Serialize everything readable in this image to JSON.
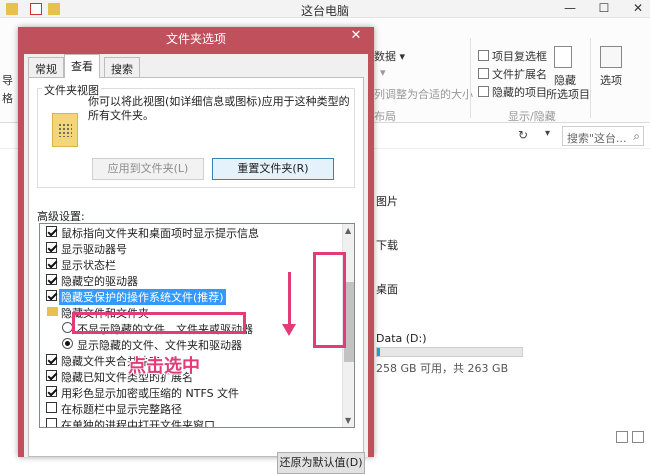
{
  "explorer": {
    "title": "这台电脑",
    "ribbon": {
      "data_partial": "数据",
      "data_arrow": "▾",
      "adjust_text": "列调整为合适的大小",
      "items_check_label": "项目复选框",
      "ext_check_label": "文件扩展名",
      "hidden_check_label": "隐藏的项目",
      "hide_btn_label": "隐藏",
      "hide_btn_label2": "所选项目",
      "options_label": "选项",
      "group_label": "显示/隐藏",
      "group2_label": "布局",
      "left_partial1": "导",
      "left_partial2": "格"
    },
    "search_placeholder": "搜索\"这台...",
    "folders": [
      "图片",
      "下载",
      "桌面"
    ],
    "drive": {
      "label": "Data (D:)",
      "free_text": "258 GB 可用，共 263 GB",
      "used_fraction": 0.02
    }
  },
  "dialog": {
    "title": "文件夹选项",
    "close_glyph": "✕",
    "tabs": [
      "常规",
      "查看",
      "搜索"
    ],
    "folder_view": {
      "label": "文件夹视图",
      "description": "你可以将此视图(如详细信息或图标)应用于这种类型的所有文件夹。",
      "apply_btn": "应用到文件夹(L)",
      "reset_btn": "重置文件夹(R)"
    },
    "advanced_label": "高级设置:",
    "advanced_items": [
      {
        "text": "鼠标指向文件夹和桌面项时显示提示信息",
        "type": "checkbox",
        "checked": true
      },
      {
        "text": "显示驱动器号",
        "type": "checkbox",
        "checked": true
      },
      {
        "text": "显示状态栏",
        "type": "checkbox",
        "checked": true
      },
      {
        "text": "隐藏空的驱动器",
        "type": "checkbox",
        "checked": true
      },
      {
        "text": "隐藏受保护的操作系统文件(推荐)",
        "type": "checkbox",
        "checked": true,
        "selected": true
      },
      {
        "text": "隐藏文件和文件夹",
        "type": "folder"
      },
      {
        "text": "不显示隐藏的文件、文件夹或驱动器",
        "type": "radio",
        "checked": false
      },
      {
        "text": "显示隐藏的文件、文件夹和驱动器",
        "type": "radio",
        "checked": true
      },
      {
        "text": "隐藏文件夹合并冲突",
        "type": "checkbox",
        "checked": true
      },
      {
        "text": "隐藏已知文件类型的扩展名",
        "type": "checkbox",
        "checked": true
      },
      {
        "text": "用彩色显示加密或压缩的 NTFS 文件",
        "type": "checkbox",
        "checked": true
      },
      {
        "text": "在标题栏中显示完整路径",
        "type": "checkbox",
        "checked": false
      },
      {
        "text": "在单独的进程中打开文件夹窗口",
        "type": "checkbox",
        "checked": false
      }
    ],
    "restore_btn": "还原为默认值(D)"
  },
  "annotation": {
    "text": "点击选中"
  },
  "colors": {
    "dialog_frame": "#c0505c",
    "highlight": "#e23b77",
    "selection": "#3399ff"
  }
}
